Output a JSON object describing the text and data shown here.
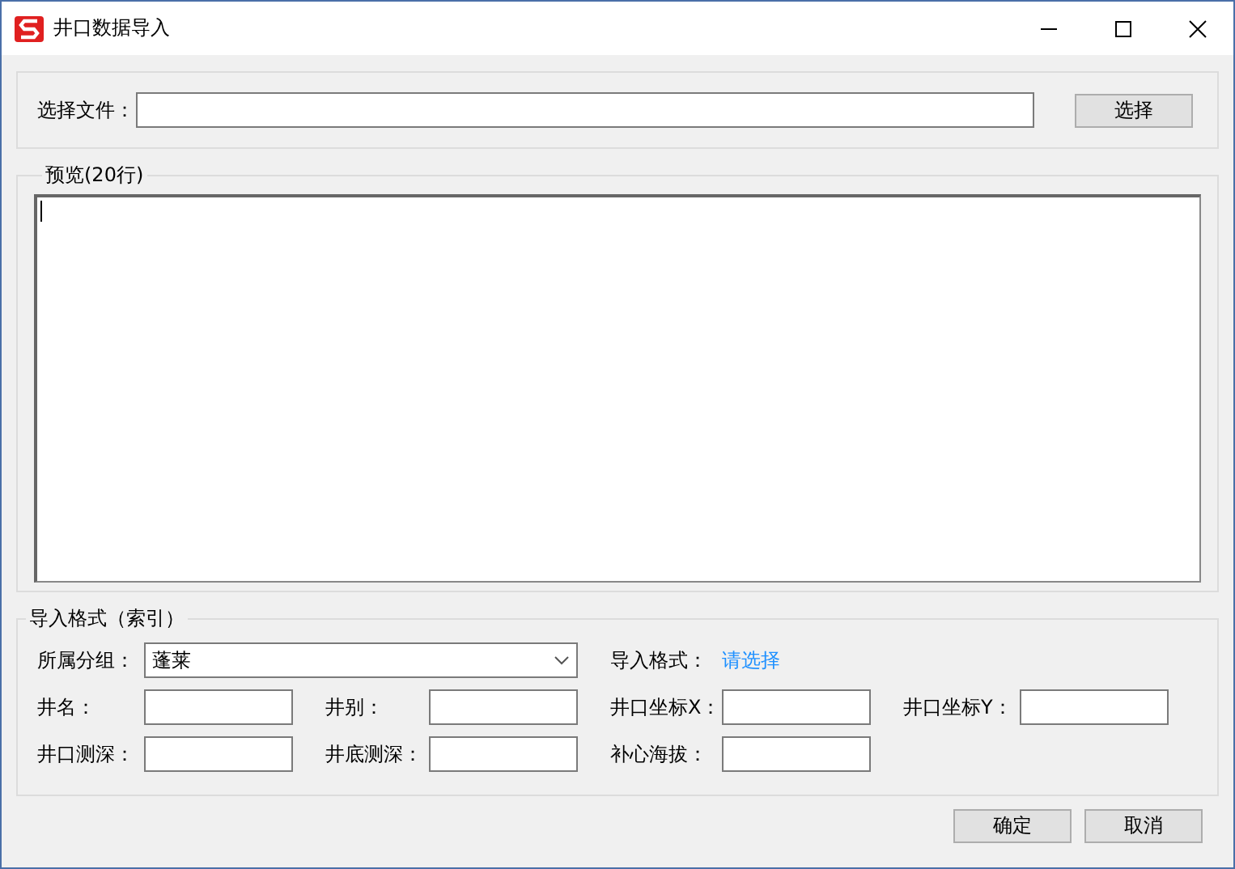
{
  "window": {
    "title": "井口数据导入"
  },
  "file": {
    "label": "选择文件：",
    "button": "选择"
  },
  "preview": {
    "title": "预览(20行)"
  },
  "format": {
    "title": "导入格式（索引）",
    "rows": [
      [
        {
          "kind": "combo",
          "label": "所属分组：",
          "value": "蓬莱"
        },
        {
          "kind": "empty"
        },
        {
          "kind": "link",
          "label": "导入格式：",
          "value": "请选择"
        }
      ],
      [
        {
          "kind": "text",
          "label": "井名："
        },
        {
          "kind": "text",
          "label": "井别："
        },
        {
          "kind": "text",
          "label": "井口坐标X："
        },
        {
          "kind": "text",
          "label": "井口坐标Y："
        }
      ],
      [
        {
          "kind": "text",
          "label": "井口测深："
        },
        {
          "kind": "text",
          "label": "井底测深："
        },
        {
          "kind": "text",
          "label": "补心海拔："
        }
      ]
    ]
  },
  "buttons": [
    "确定",
    "取消"
  ]
}
